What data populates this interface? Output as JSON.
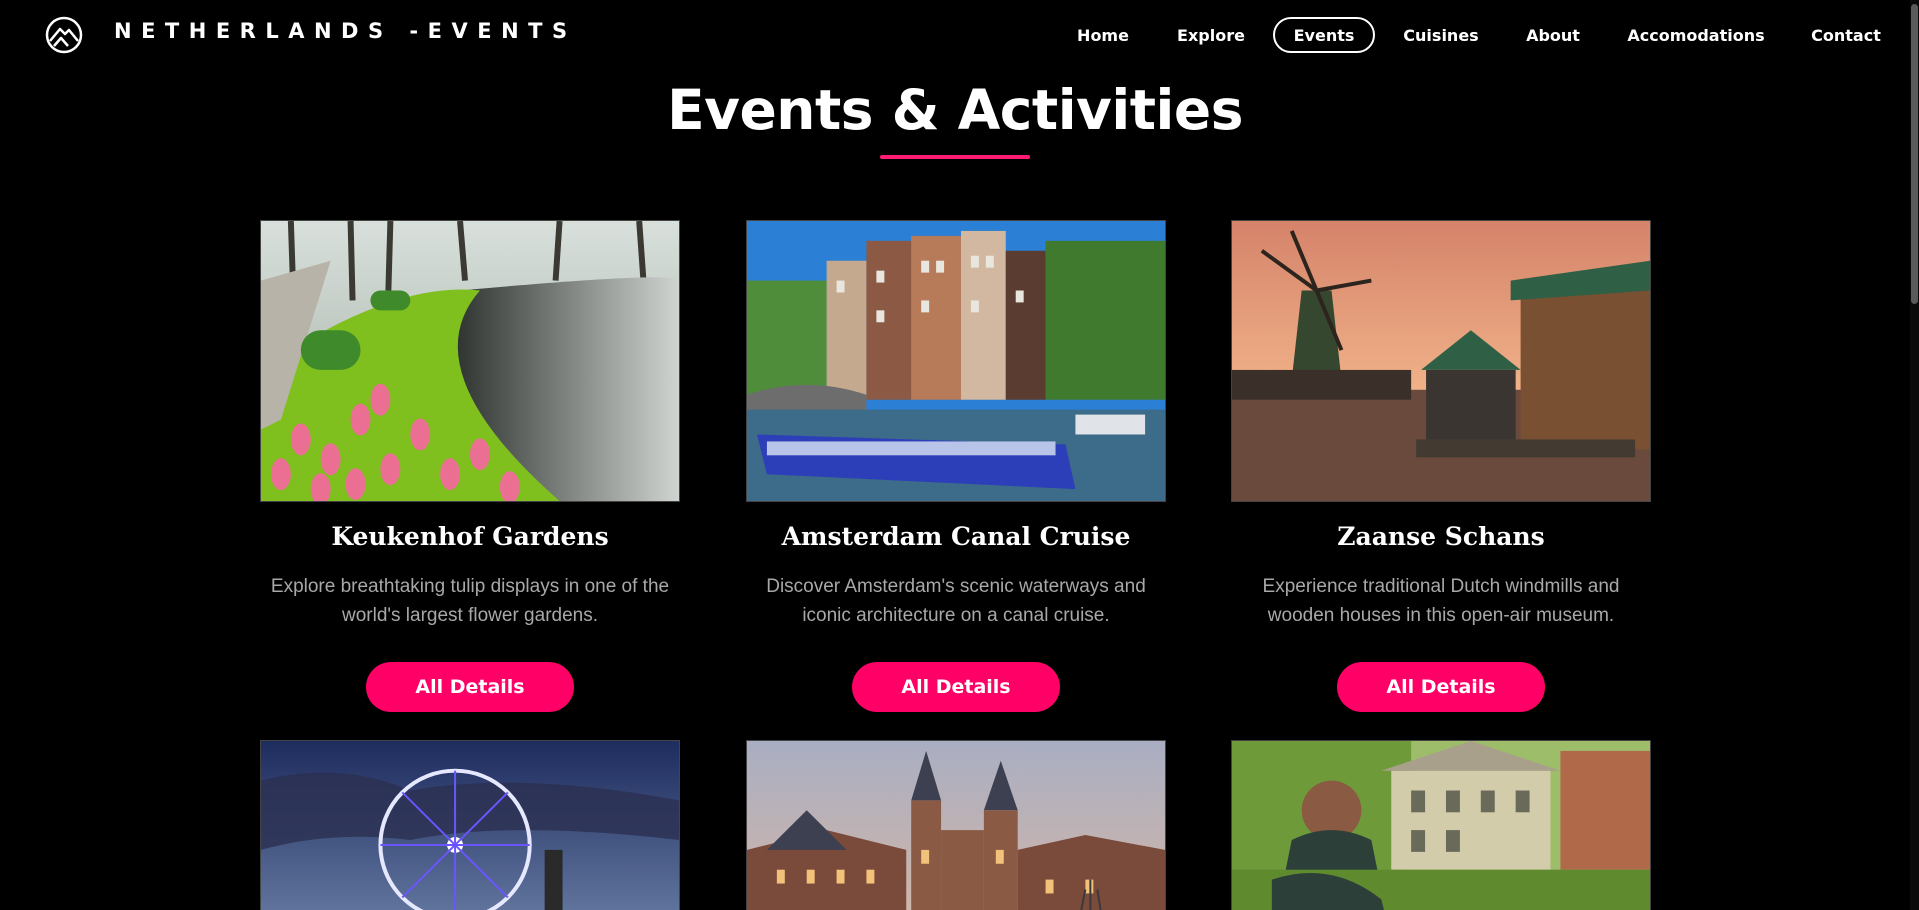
{
  "brand": {
    "name": "NETHERLANDS -EVENTS",
    "logo_icon": "mountain-circle-logo-icon"
  },
  "nav": {
    "items": [
      {
        "label": "Home"
      },
      {
        "label": "Explore"
      },
      {
        "label": "Events",
        "active": true
      },
      {
        "label": "Cuisines"
      },
      {
        "label": "About"
      },
      {
        "label": "Accomodations"
      },
      {
        "label": "Contact"
      }
    ]
  },
  "page": {
    "title": "Events & Activities",
    "accent_color": "#ff0066"
  },
  "cards": [
    {
      "title": "Keukenhof Gardens",
      "description": "Explore breathtaking tulip displays in one of the world's largest flower gardens.",
      "button": "All Details",
      "image": "tulip-garden-photo"
    },
    {
      "title": "Amsterdam Canal Cruise",
      "description": "Discover Amsterdam's scenic waterways and iconic architecture on a canal cruise.",
      "button": "All Details",
      "image": "canal-boat-photo"
    },
    {
      "title": "Zaanse Schans",
      "description": "Experience traditional Dutch windmills and wooden houses in this open-air museum.",
      "button": "All Details",
      "image": "windmill-photo"
    }
  ],
  "row2_images": [
    "ferris-wheel-photo",
    "rijksmuseum-photo",
    "garden-house-photo"
  ]
}
